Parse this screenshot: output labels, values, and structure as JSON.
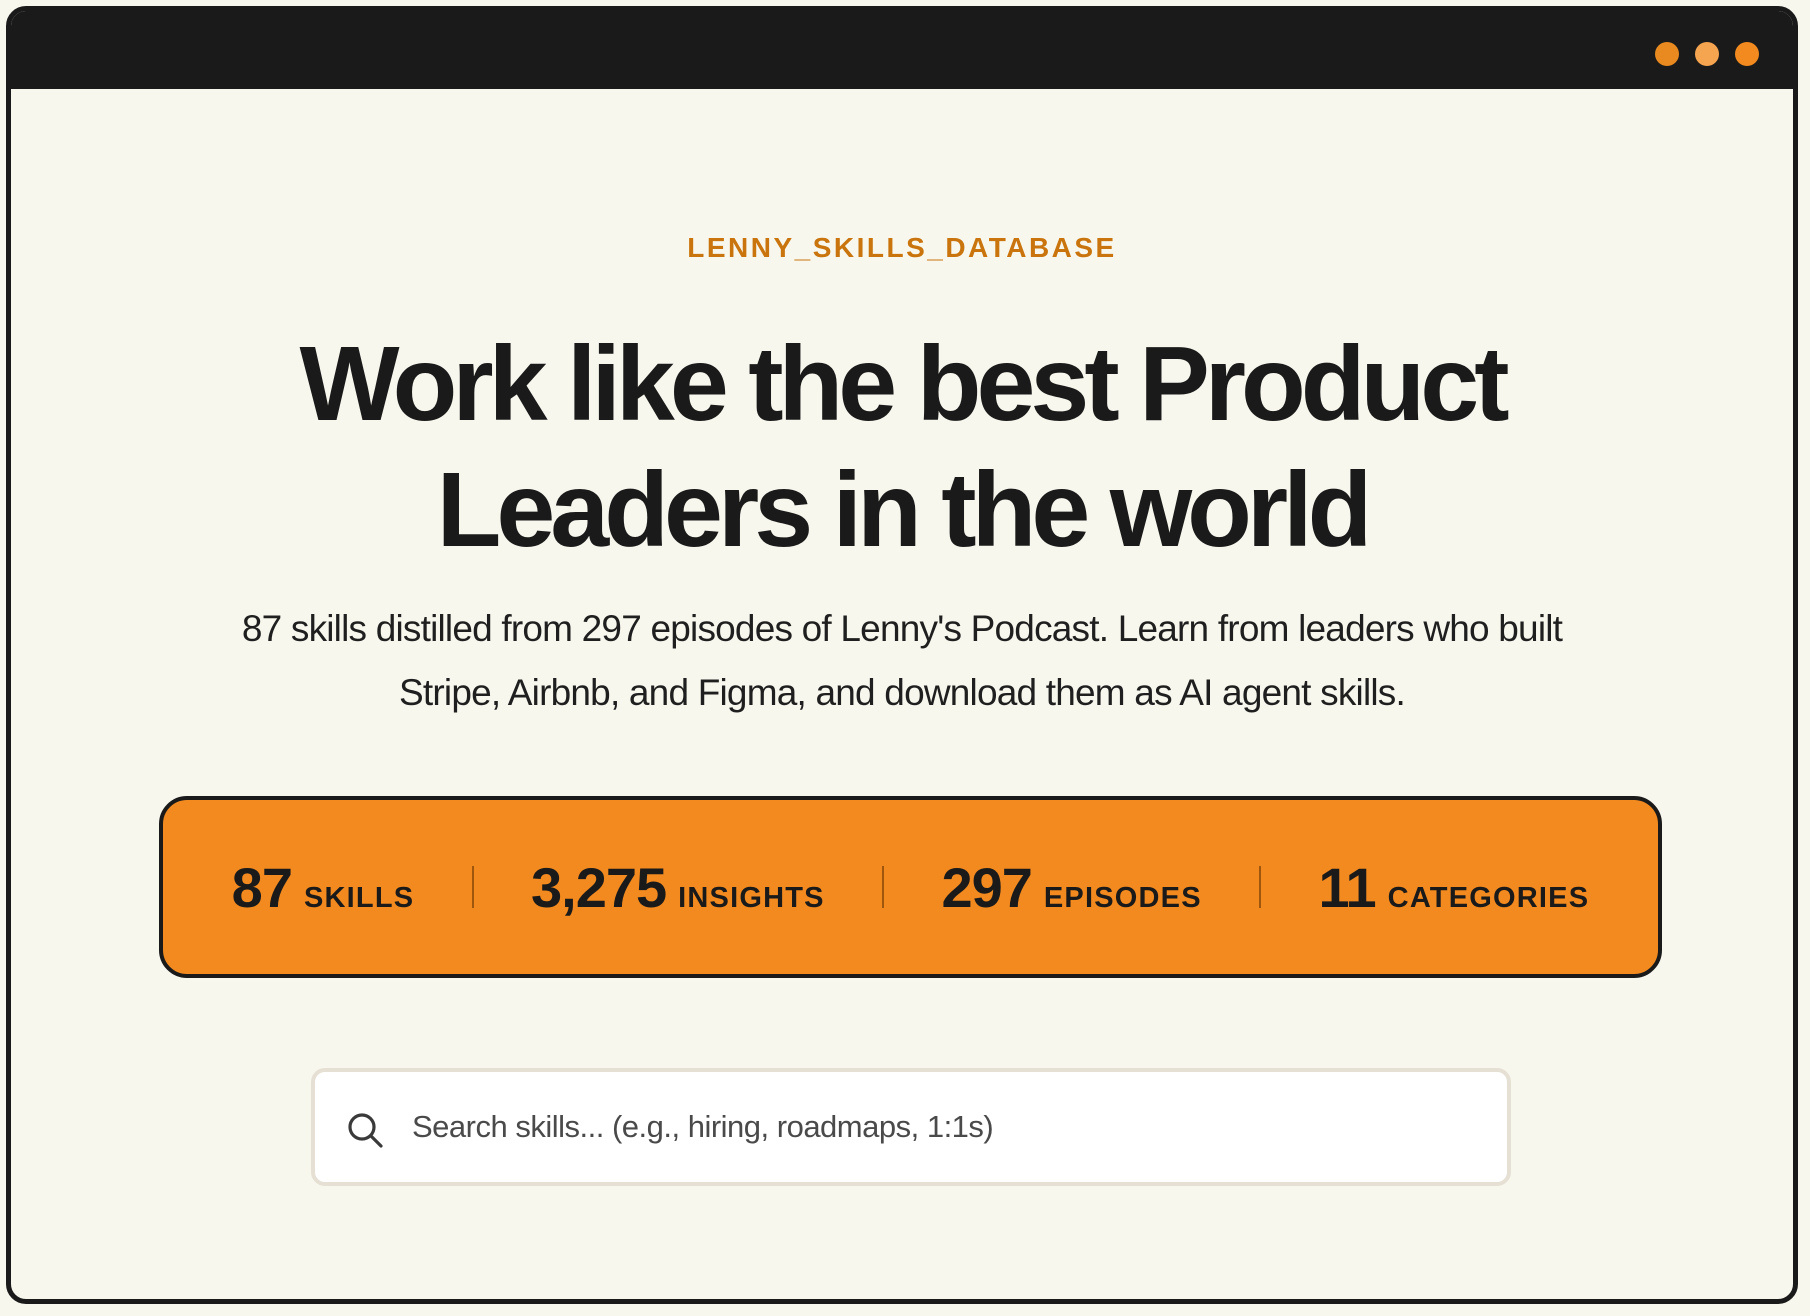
{
  "window": {
    "dots": [
      {
        "name": "window-dot-1",
        "color": "#e88a1f"
      },
      {
        "name": "window-dot-2",
        "color": "#f5a550"
      },
      {
        "name": "window-dot-3",
        "color": "#f28a1f"
      }
    ]
  },
  "hero": {
    "eyebrow": "LENNY_SKILLS_DATABASE",
    "headline_line1": "Work like the best Product",
    "headline_line2": "Leaders in the world",
    "subtitle": "87 skills distilled from 297 episodes of Lenny's Podcast. Learn from leaders who built Stripe, Airbnb, and Figma, and download them as AI agent skills."
  },
  "stats": [
    {
      "value": "87",
      "label": "SKILLS"
    },
    {
      "value": "3,275",
      "label": "INSIGHTS"
    },
    {
      "value": "297",
      "label": "EPISODES"
    },
    {
      "value": "11",
      "label": "CATEGORIES"
    }
  ],
  "search": {
    "value": "",
    "placeholder": "Search skills... (e.g., hiring, roadmaps, 1:1s)",
    "icon": "search-icon"
  },
  "colors": {
    "accent": "#f28a1f",
    "eyebrow": "#c9740c",
    "ink": "#1a1a1a",
    "background": "#f8f7ee"
  }
}
